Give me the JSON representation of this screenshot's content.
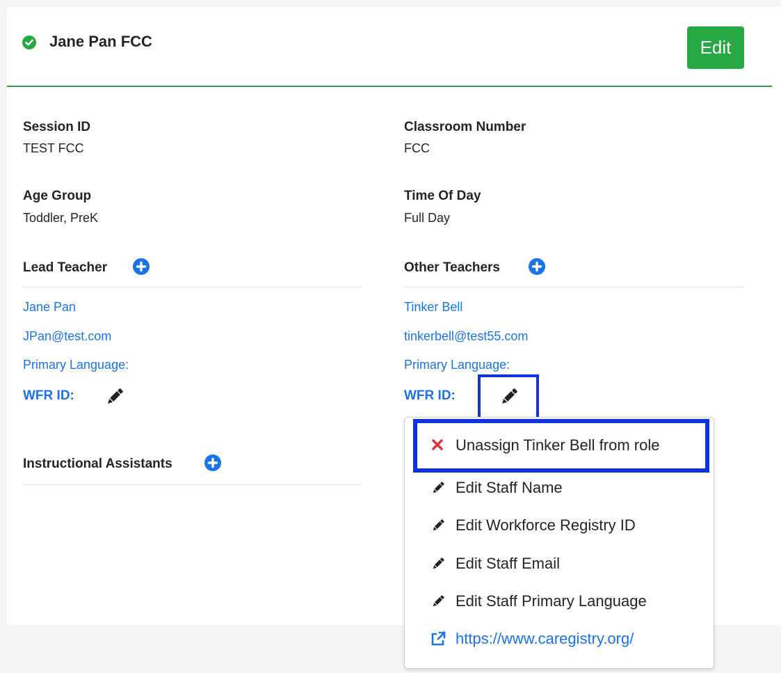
{
  "header": {
    "title": "Jane Pan FCC",
    "edit_label": "Edit",
    "status_icon": "check-circle-icon"
  },
  "fields": {
    "session_id": {
      "label": "Session ID",
      "value": "TEST FCC"
    },
    "classroom_number": {
      "label": "Classroom Number",
      "value": "FCC"
    },
    "age_group": {
      "label": "Age Group",
      "value": "Toddler, PreK"
    },
    "time_of_day": {
      "label": "Time Of Day",
      "value": "Full Day"
    }
  },
  "lead_teacher": {
    "heading": "Lead Teacher",
    "name": "Jane Pan",
    "email": "JPan@test.com",
    "primary_language": "Primary Language:",
    "wfr_label": "WFR ID:"
  },
  "other_teachers": {
    "heading": "Other Teachers",
    "name": "Tinker Bell",
    "email": "tinkerbell@test55.com",
    "primary_language": "Primary Language:",
    "wfr_label": "WFR ID:"
  },
  "instructional_assistants": {
    "heading": "Instructional Assistants"
  },
  "menu": {
    "items": [
      {
        "label": "Unassign Tinker Bell from role",
        "icon": "x-icon"
      },
      {
        "label": "Edit Staff Name",
        "icon": "pencil-icon"
      },
      {
        "label": "Edit Workforce Registry ID",
        "icon": "pencil-icon"
      },
      {
        "label": "Edit Staff Email",
        "icon": "pencil-icon"
      },
      {
        "label": "Edit Staff Primary Language",
        "icon": "pencil-icon"
      },
      {
        "label": "https://www.caregistry.org/",
        "icon": "external-link-icon"
      }
    ]
  },
  "colors": {
    "accent_green": "#28a745",
    "link_blue": "#1a73e8",
    "highlight_blue": "#1133dd",
    "danger_red": "#dc3545"
  }
}
